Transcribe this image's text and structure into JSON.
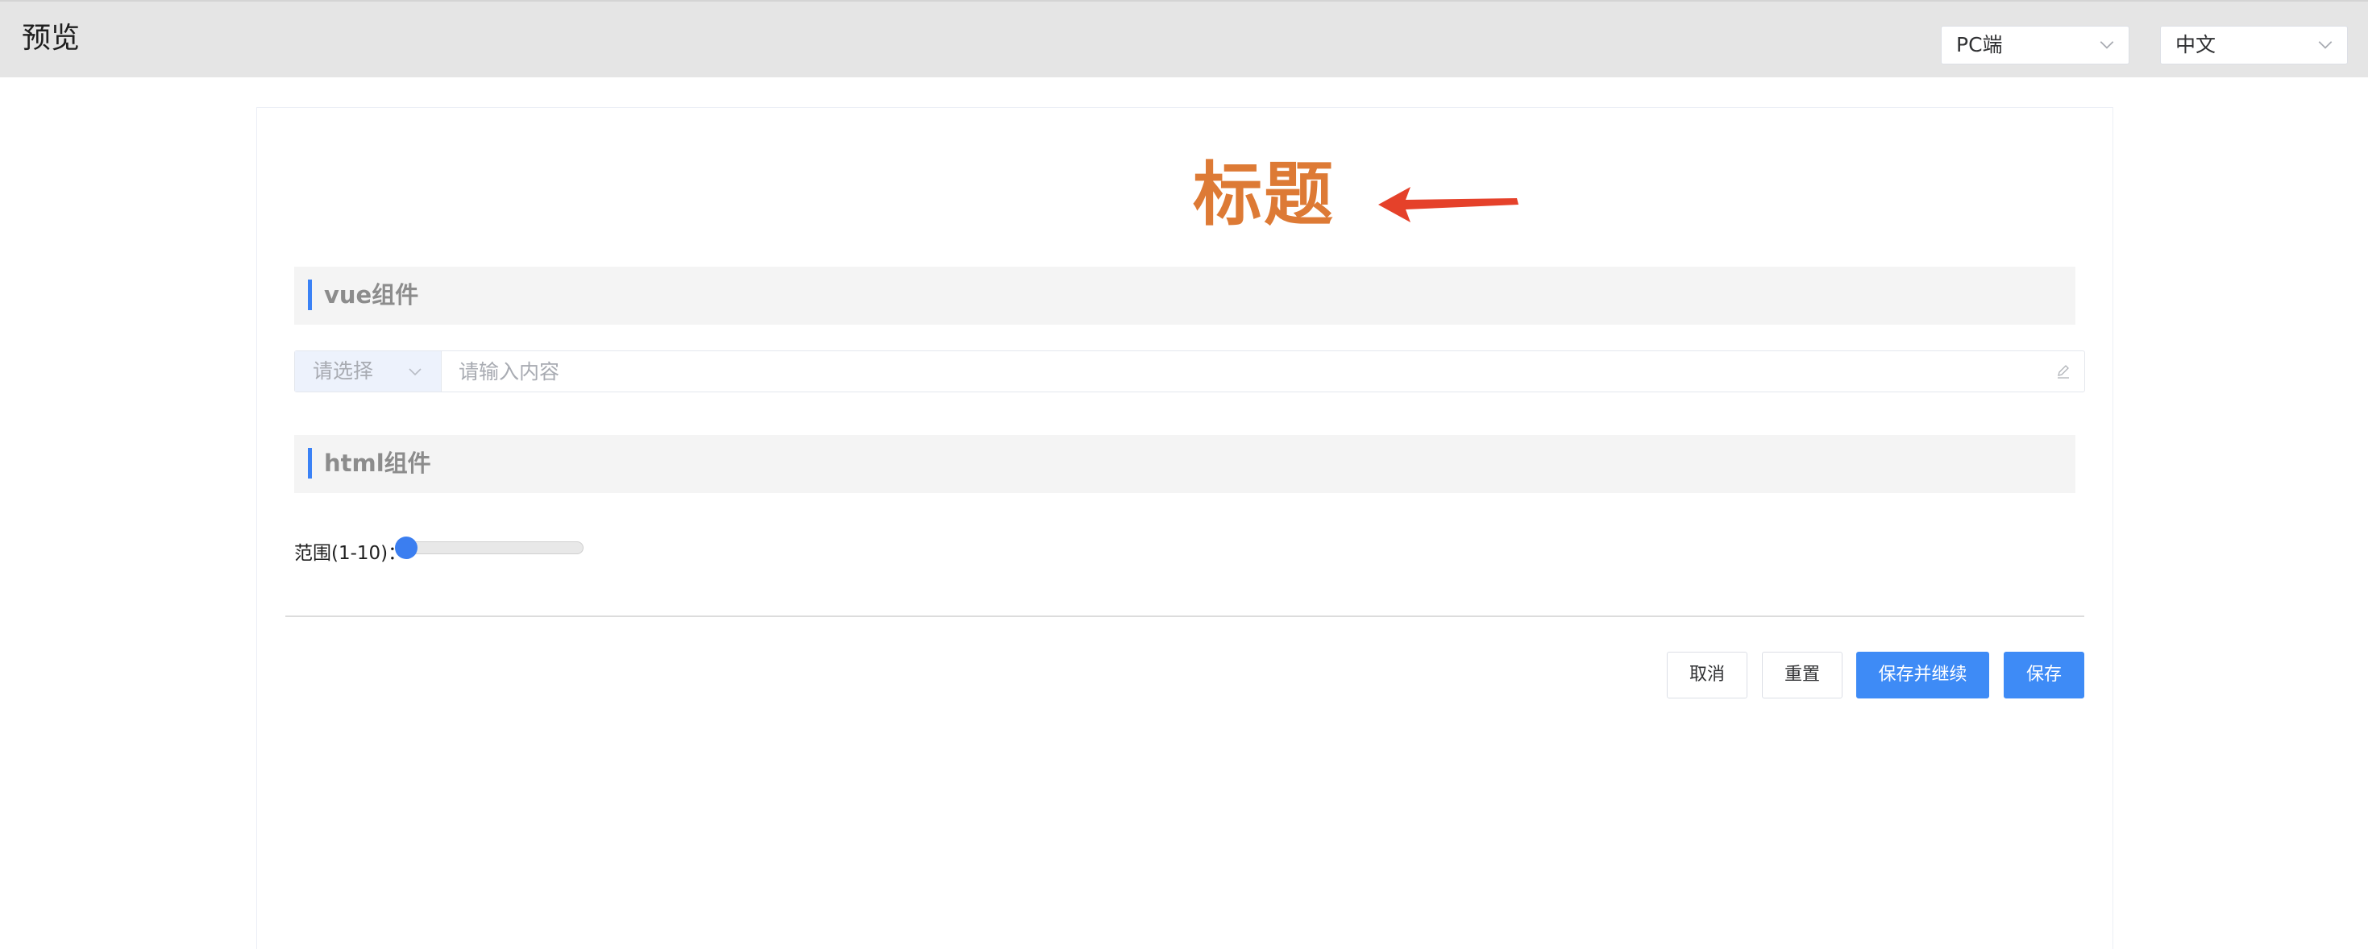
{
  "header": {
    "title": "预览",
    "platform_select": {
      "value": "PC端"
    },
    "language_select": {
      "value": "中文"
    }
  },
  "form": {
    "title": "标题",
    "title_color": "#dd7a35",
    "annotation_arrow_color": "#e5412a",
    "sections": {
      "vue": {
        "title": "vue组件"
      },
      "html": {
        "title": "html组件"
      }
    },
    "input_group": {
      "select_placeholder": "请选择",
      "input_placeholder": "请输入内容"
    },
    "range": {
      "label": "范围(1-10)：",
      "min": 1,
      "max": 10,
      "value": 1
    }
  },
  "actions": {
    "cancel": "取消",
    "reset": "重置",
    "save_continue": "保存并继续",
    "save": "保存"
  },
  "colors": {
    "accent": "#3e8bf6",
    "section_bar": "#3b82f6",
    "header_bg": "#e5e5e5"
  }
}
